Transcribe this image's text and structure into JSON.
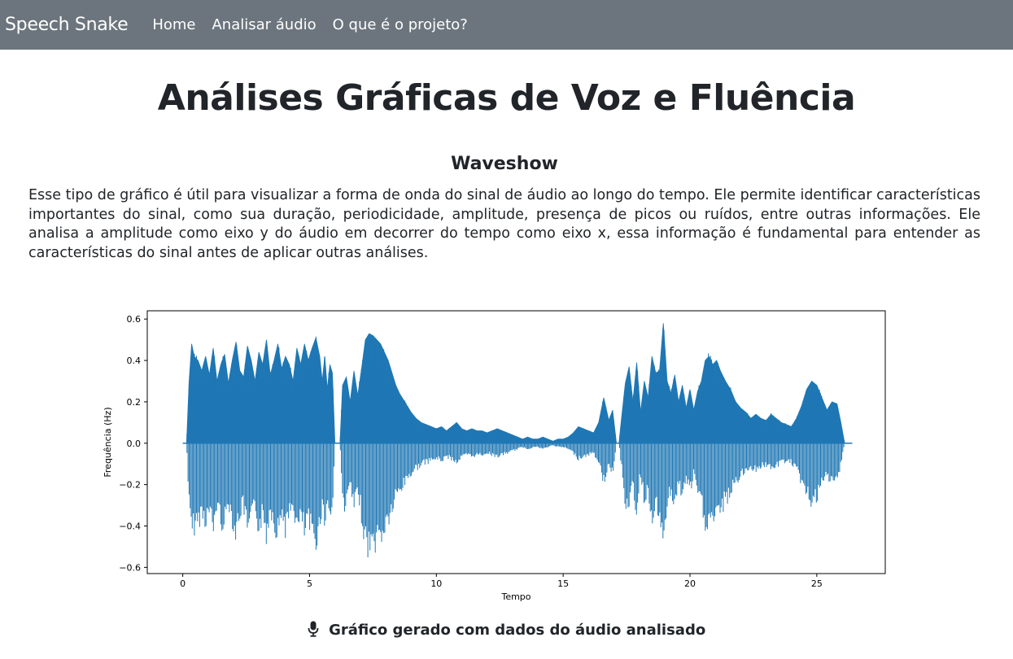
{
  "navbar": {
    "brand": "Speech Snake",
    "links": [
      "Home",
      "Analisar áudio",
      "O que é o projeto?"
    ]
  },
  "page": {
    "title": "Análises Gráficas de Voz e Fluência",
    "section_title": "Waveshow",
    "description": "Esse tipo de gráfico é útil para visualizar a forma de onda do sinal de áudio ao longo do tempo. Ele permite identificar características importantes do sinal, como sua duração, periodicidade, amplitude, presença de picos ou ruídos, entre outras informações. Ele analisa a amplitude como eixo y do áudio em decorrer do tempo como eixo x, essa informação é fundamental para entender as características do sinal antes de aplicar outras análises.",
    "caption": "Gráfico gerado com dados do áudio analisado",
    "caption_icon": "microphone-icon"
  },
  "chart_data": {
    "type": "area",
    "title": "",
    "xlabel": "Tempo",
    "ylabel": "Frequência (Hz)",
    "xlim": [
      -1.4,
      27.7
    ],
    "ylim": [
      -0.63,
      0.64
    ],
    "xticks": [
      0,
      5,
      10,
      15,
      20,
      25
    ],
    "xtick_labels": [
      "0",
      "5",
      "10",
      "15",
      "20",
      "25"
    ],
    "yticks": [
      0.6,
      0.4,
      0.2,
      0.0,
      -0.2,
      -0.4,
      -0.6
    ],
    "ytick_labels": [
      "0.6",
      "0.4",
      "0.2",
      "0.0",
      "−0.2",
      "−0.4",
      "−0.6"
    ],
    "color": "#1f77b4",
    "grid": false,
    "series": [
      {
        "x": [
          0.0,
          0.15,
          0.25,
          0.35,
          0.45,
          0.6,
          0.75,
          0.9,
          1.05,
          1.2,
          1.35,
          1.5,
          1.65,
          1.8,
          1.95,
          2.1,
          2.25,
          2.4,
          2.55,
          2.7,
          2.85,
          3.0,
          3.15,
          3.3,
          3.45,
          3.6,
          3.75,
          3.9,
          4.05,
          4.2,
          4.35,
          4.5,
          4.65,
          4.8,
          4.95,
          5.1,
          5.25,
          5.4,
          5.5,
          5.6,
          5.7,
          5.8,
          5.9,
          6.0,
          6.1,
          6.2,
          6.3,
          6.45,
          6.6,
          6.75,
          6.9,
          7.05,
          7.2,
          7.35,
          7.5,
          7.65,
          7.8,
          7.95,
          8.1,
          8.25,
          8.4,
          8.55,
          8.7,
          8.85,
          9.0,
          9.2,
          9.4,
          9.6,
          9.8,
          10.0,
          10.2,
          10.4,
          10.6,
          10.8,
          11.0,
          11.2,
          11.4,
          11.6,
          11.8,
          12.0,
          12.2,
          12.4,
          12.6,
          12.8,
          13.0,
          13.2,
          13.4,
          13.6,
          13.8,
          14.0,
          14.2,
          14.4,
          14.6,
          14.8,
          15.0,
          15.2,
          15.4,
          15.6,
          15.8,
          16.0,
          16.2,
          16.4,
          16.6,
          16.8,
          16.95,
          17.1,
          17.2,
          17.3,
          17.45,
          17.6,
          17.75,
          17.9,
          18.05,
          18.2,
          18.35,
          18.5,
          18.65,
          18.8,
          18.95,
          19.1,
          19.25,
          19.4,
          19.55,
          19.7,
          19.85,
          20.0,
          20.15,
          20.3,
          20.45,
          20.6,
          20.75,
          20.9,
          21.05,
          21.2,
          21.4,
          21.6,
          21.8,
          22.0,
          22.2,
          22.4,
          22.6,
          22.8,
          23.0,
          23.2,
          23.4,
          23.6,
          23.8,
          24.0,
          24.2,
          24.4,
          24.6,
          24.8,
          25.0,
          25.2,
          25.4,
          25.6,
          25.8,
          25.95,
          26.1,
          26.2,
          26.4
        ],
        "upper": [
          0.0,
          0.0,
          0.3,
          0.48,
          0.42,
          0.4,
          0.35,
          0.42,
          0.33,
          0.46,
          0.3,
          0.38,
          0.43,
          0.29,
          0.4,
          0.49,
          0.35,
          0.32,
          0.47,
          0.4,
          0.3,
          0.44,
          0.38,
          0.5,
          0.33,
          0.4,
          0.48,
          0.36,
          0.42,
          0.38,
          0.3,
          0.46,
          0.38,
          0.48,
          0.4,
          0.46,
          0.51,
          0.42,
          0.3,
          0.42,
          0.26,
          0.38,
          0.34,
          0.0,
          0.0,
          0.0,
          0.28,
          0.32,
          0.2,
          0.35,
          0.23,
          0.36,
          0.5,
          0.53,
          0.52,
          0.5,
          0.48,
          0.44,
          0.4,
          0.34,
          0.28,
          0.24,
          0.21,
          0.18,
          0.15,
          0.12,
          0.1,
          0.09,
          0.08,
          0.07,
          0.08,
          0.06,
          0.08,
          0.1,
          0.07,
          0.06,
          0.07,
          0.06,
          0.06,
          0.05,
          0.06,
          0.07,
          0.06,
          0.05,
          0.04,
          0.03,
          0.02,
          0.03,
          0.02,
          0.02,
          0.03,
          0.02,
          0.01,
          0.02,
          0.02,
          0.03,
          0.05,
          0.08,
          0.07,
          0.06,
          0.05,
          0.1,
          0.22,
          0.11,
          0.16,
          0.0,
          0.0,
          0.12,
          0.29,
          0.37,
          0.2,
          0.39,
          0.15,
          0.3,
          0.22,
          0.42,
          0.34,
          0.35,
          0.58,
          0.3,
          0.24,
          0.33,
          0.2,
          0.28,
          0.17,
          0.26,
          0.16,
          0.25,
          0.3,
          0.4,
          0.42,
          0.38,
          0.4,
          0.35,
          0.3,
          0.26,
          0.2,
          0.17,
          0.15,
          0.12,
          0.14,
          0.12,
          0.11,
          0.14,
          0.12,
          0.1,
          0.09,
          0.08,
          0.12,
          0.18,
          0.26,
          0.3,
          0.28,
          0.22,
          0.16,
          0.2,
          0.19,
          0.1,
          0.0
        ],
        "lower": [
          0.0,
          0.0,
          -0.32,
          -0.47,
          -0.43,
          -0.41,
          -0.36,
          -0.4,
          -0.35,
          -0.46,
          -0.31,
          -0.4,
          -0.42,
          -0.3,
          -0.39,
          -0.48,
          -0.36,
          -0.33,
          -0.46,
          -0.41,
          -0.31,
          -0.45,
          -0.37,
          -0.48,
          -0.33,
          -0.41,
          -0.47,
          -0.35,
          -0.44,
          -0.39,
          -0.31,
          -0.45,
          -0.39,
          -0.46,
          -0.41,
          -0.47,
          -0.5,
          -0.43,
          -0.31,
          -0.44,
          -0.27,
          -0.39,
          -0.35,
          0.0,
          0.0,
          0.0,
          -0.3,
          -0.33,
          -0.2,
          -0.35,
          -0.24,
          -0.37,
          -0.52,
          -0.54,
          -0.53,
          -0.5,
          -0.49,
          -0.45,
          -0.4,
          -0.35,
          -0.28,
          -0.25,
          -0.22,
          -0.18,
          -0.16,
          -0.13,
          -0.11,
          -0.1,
          -0.09,
          -0.08,
          -0.09,
          -0.07,
          -0.08,
          -0.1,
          -0.07,
          -0.06,
          -0.07,
          -0.06,
          -0.06,
          -0.05,
          -0.06,
          -0.07,
          -0.06,
          -0.05,
          -0.04,
          -0.03,
          -0.02,
          -0.03,
          -0.02,
          -0.02,
          -0.03,
          -0.02,
          -0.01,
          -0.02,
          -0.02,
          -0.03,
          -0.05,
          -0.08,
          -0.07,
          -0.06,
          -0.05,
          -0.1,
          -0.2,
          -0.11,
          -0.16,
          0.0,
          0.0,
          -0.12,
          -0.3,
          -0.36,
          -0.2,
          -0.38,
          -0.15,
          -0.31,
          -0.22,
          -0.43,
          -0.34,
          -0.36,
          -0.58,
          -0.31,
          -0.24,
          -0.33,
          -0.2,
          -0.29,
          -0.17,
          -0.26,
          -0.16,
          -0.26,
          -0.31,
          -0.41,
          -0.42,
          -0.38,
          -0.4,
          -0.35,
          -0.3,
          -0.26,
          -0.2,
          -0.17,
          -0.15,
          -0.12,
          -0.14,
          -0.12,
          -0.11,
          -0.14,
          -0.12,
          -0.1,
          -0.09,
          -0.1,
          -0.14,
          -0.2,
          -0.27,
          -0.3,
          -0.29,
          -0.22,
          -0.17,
          -0.2,
          -0.2,
          -0.1,
          0.0
        ]
      }
    ]
  }
}
